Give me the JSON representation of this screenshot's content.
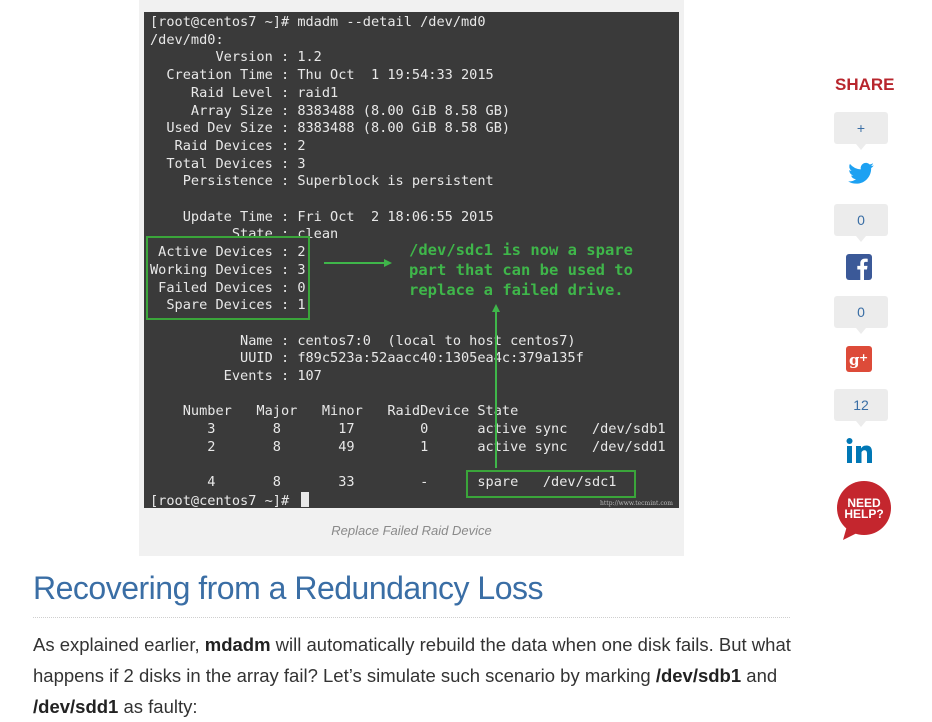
{
  "terminal": {
    "lines": [
      "[root@centos7 ~]# mdadm --detail /dev/md0",
      "/dev/md0:",
      "        Version : 1.2",
      "  Creation Time : Thu Oct  1 19:54:33 2015",
      "     Raid Level : raid1",
      "     Array Size : 8383488 (8.00 GiB 8.58 GB)",
      "  Used Dev Size : 8383488 (8.00 GiB 8.58 GB)",
      "   Raid Devices : 2",
      "  Total Devices : 3",
      "    Persistence : Superblock is persistent",
      "",
      "    Update Time : Fri Oct  2 18:06:55 2015",
      "          State : clean",
      " Active Devices : 2",
      "Working Devices : 3",
      " Failed Devices : 0",
      "  Spare Devices : 1",
      "",
      "           Name : centos7:0  (local to host centos7)",
      "           UUID : f89c523a:52aacc40:1305ea4c:379a135f",
      "         Events : 107",
      "",
      "    Number   Major   Minor   RaidDevice State",
      "       3       8       17        0      active sync   /dev/sdb1",
      "       2       8       49        1      active sync   /dev/sdd1",
      "",
      "       4       8       33        -      spare   /dev/sdc1",
      "[root@centos7 ~]# "
    ],
    "annotation": "/dev/sdc1 is now a spare part that can be used to replace a failed drive.",
    "watermark": "http://www.tecmint.com"
  },
  "caption": "Replace Failed Raid Device",
  "share": {
    "title": "SHARE",
    "plus_label": "+",
    "twitter_count": "0",
    "facebook_count": "0",
    "linkedin_count": "12",
    "need_help_label": "NEED HELP?"
  },
  "colors": {
    "brand_red": "#b8262d",
    "heading_blue": "#3a6ea5",
    "annotation_green": "#3fb64a",
    "twitter": "#1da1f2",
    "facebook": "#3b5998",
    "googleplus": "#dd4b39",
    "linkedin": "#0077b5"
  },
  "article": {
    "heading": "Recovering from a Redundancy Loss",
    "p_part1": "As explained earlier, ",
    "p_mdadm": "mdadm",
    "p_part2": " will automatically rebuild the data when one disk fails. But what happens if 2 disks in the array fail? Let’s simulate such scenario by marking ",
    "p_sdb1": "/dev/sdb1",
    "p_part3": " and ",
    "p_sdd1": "/dev/sdd1",
    "p_part4": " as faulty:"
  }
}
